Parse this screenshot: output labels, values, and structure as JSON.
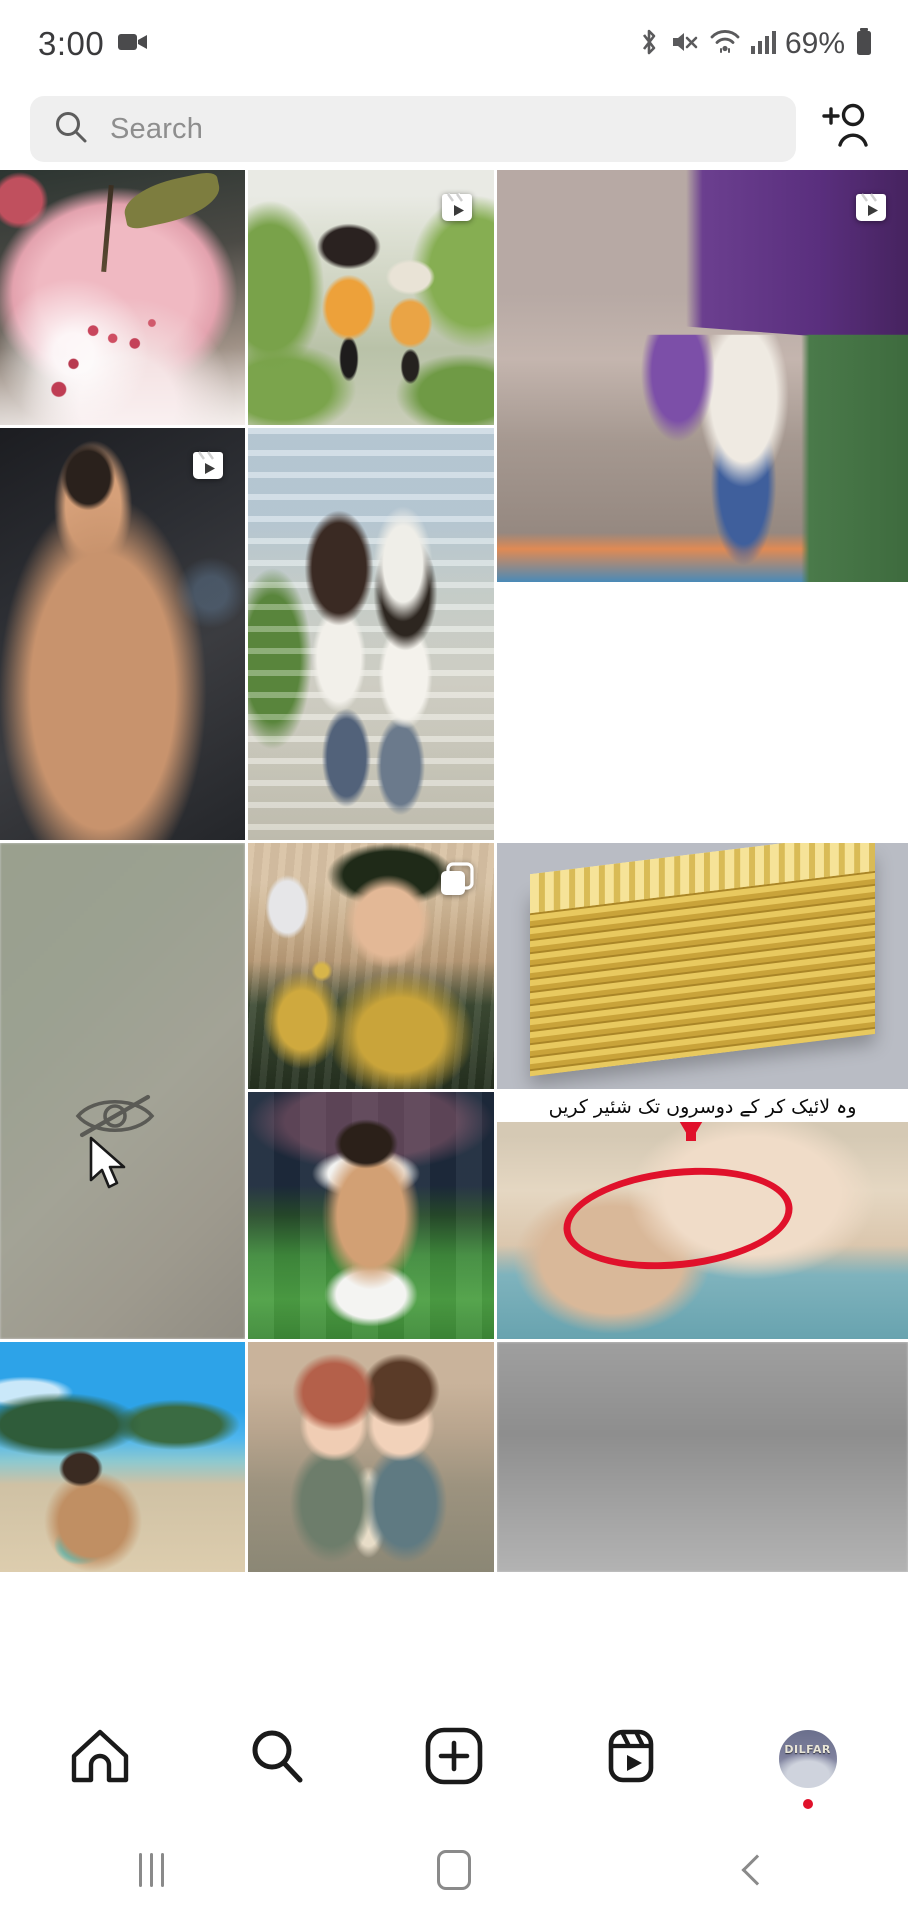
{
  "status_bar": {
    "clock": "3:00",
    "battery_percent": "69%",
    "icons": [
      "screen-recorder-icon",
      "bluetooth-icon",
      "mute-icon",
      "wifi-icon",
      "cellular-signal-icon",
      "battery-icon"
    ]
  },
  "header": {
    "search": {
      "placeholder": "Search",
      "value": "",
      "icon": "search-icon"
    },
    "add_person_icon": "add-person-icon"
  },
  "explore": {
    "tiles": [
      {
        "id": "tile-1",
        "alt": "Frosted pink apple with cherry blossom branch",
        "media_type": "photo",
        "badge": null
      },
      {
        "id": "tile-2",
        "alt": "3D cartoon kids in orange hoodies walking",
        "media_type": "reel",
        "badge": "reel-icon"
      },
      {
        "id": "tile-3",
        "alt": "Taekwondo athlete at Gymnastics gym",
        "media_type": "reel",
        "badge": "reel-icon"
      },
      {
        "id": "tile-4",
        "alt": "Shirtless muscular man in gym",
        "media_type": "reel",
        "badge": "reel-icon"
      },
      {
        "id": "tile-5",
        "alt": "Two chibi cartoon kids sitting on steps",
        "media_type": "photo",
        "badge": null
      },
      {
        "id": "tile-6",
        "alt": "Blurred sage green placeholder",
        "media_type": "hidden",
        "badge": null
      },
      {
        "id": "tile-7",
        "alt": "Bride in green and gold taking a selfie",
        "media_type": "carousel",
        "badge": "carousel-icon"
      },
      {
        "id": "tile-8",
        "alt": "Cube of stacked gold bars on pallet",
        "media_type": "photo",
        "badge": null
      },
      {
        "id": "tile-9",
        "alt": "Footballer celebrating, shirt pulled up",
        "media_type": "photo",
        "badge": null
      },
      {
        "id": "tile-10",
        "alt": "Close up of a baby eye with red circle marker",
        "media_type": "photo",
        "badge": null,
        "overlay_text": "وہ لائیک کر کے دوسروں تک شئیر کریں"
      },
      {
        "id": "tile-11",
        "alt": "Boy sitting on a tropical beach",
        "media_type": "photo",
        "badge": null
      },
      {
        "id": "tile-12",
        "alt": "3D cartoon couple with backpacks",
        "media_type": "photo",
        "badge": null
      },
      {
        "id": "tile-13",
        "alt": "Blurred gray placeholder",
        "media_type": "hidden",
        "badge": null
      }
    ],
    "hidden_overlay": {
      "eye_slash_icon": "eye-slash-icon",
      "cursor_icon": "mouse-cursor-icon"
    }
  },
  "tab_bar": {
    "items": [
      {
        "name": "home",
        "icon": "home-icon",
        "label": "Home",
        "active": true,
        "badge": null
      },
      {
        "name": "search",
        "icon": "search-icon",
        "label": "Search",
        "active": false,
        "badge": null
      },
      {
        "name": "create",
        "icon": "plus-box-icon",
        "label": "Create",
        "active": false,
        "badge": null
      },
      {
        "name": "reels",
        "icon": "reels-icon",
        "label": "Reels",
        "active": false,
        "badge": null
      },
      {
        "name": "profile",
        "icon": "avatar-icon",
        "label": "Profile",
        "active": false,
        "badge": "notification-dot",
        "avatar_text": "DILFAR"
      }
    ]
  },
  "nav_bar": {
    "recents_label": "Recents",
    "home_label": "Home",
    "back_label": "Back"
  },
  "colors": {
    "accent_red": "#e0112b",
    "search_bg": "#efefef",
    "placeholder_text": "#8e8e8e",
    "icon_dark": "#262626",
    "nav_icon": "#8a8a8a"
  }
}
